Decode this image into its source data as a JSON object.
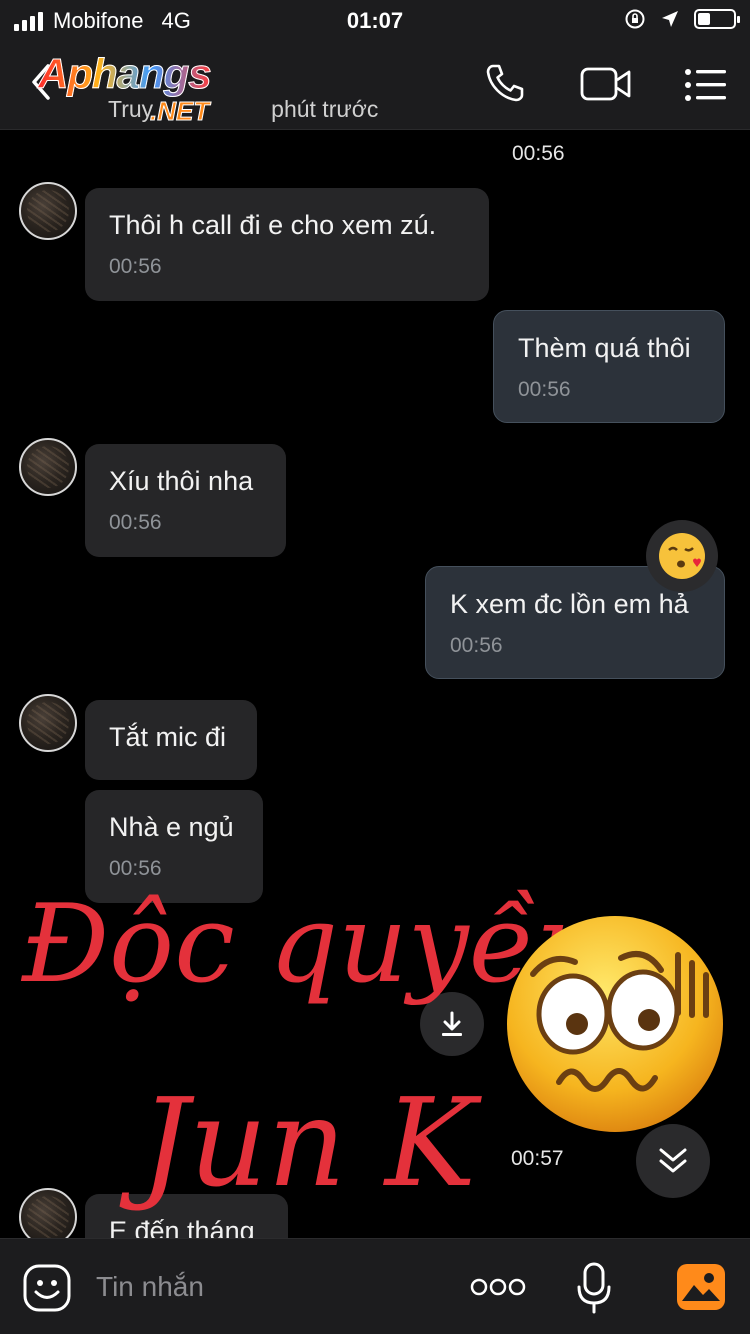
{
  "status_bar": {
    "carrier": "Mobifone",
    "network": "4G",
    "time": "01:07",
    "battery_level": 0.35
  },
  "header": {
    "brand": "Aphangs",
    "brand_suffix": ".NET",
    "subtitle_start": "Truy",
    "subtitle_end": "phút trước",
    "icons": [
      "back-icon",
      "phone-icon",
      "video-call-icon",
      "menu-icon"
    ]
  },
  "chat": {
    "timestamp_top": "00:56",
    "messages": [
      {
        "side": "in",
        "text": "Thôi h call đi e cho xem zú.",
        "time": "00:56"
      },
      {
        "side": "out",
        "text": "Thèm quá thôi",
        "time": "00:56"
      },
      {
        "side": "in",
        "text": "Xíu thôi nha",
        "time": "00:56"
      },
      {
        "side": "out",
        "text": "K xem đc lồn em hả",
        "time": "00:56",
        "reaction": "kissing-face-emoji"
      },
      {
        "side": "in",
        "text": "Tắt mic đi"
      },
      {
        "side": "in",
        "text": "Nhà e ngủ",
        "time": "00:56"
      }
    ],
    "timestamp_bottom": "00:57",
    "partial_message": "E đến tháng"
  },
  "watermark": {
    "line1": "Độc quyền",
    "line2": "Jun K"
  },
  "input_bar": {
    "placeholder": "Tin nhắn",
    "icons": [
      "sticker-icon",
      "more-options-icon",
      "microphone-icon",
      "gallery-icon"
    ]
  },
  "colors": {
    "accent_orange": "#ff8a1a",
    "watermark_red": "#e4313b",
    "bubble_in": "#262628",
    "bubble_out": "#2c323a"
  }
}
